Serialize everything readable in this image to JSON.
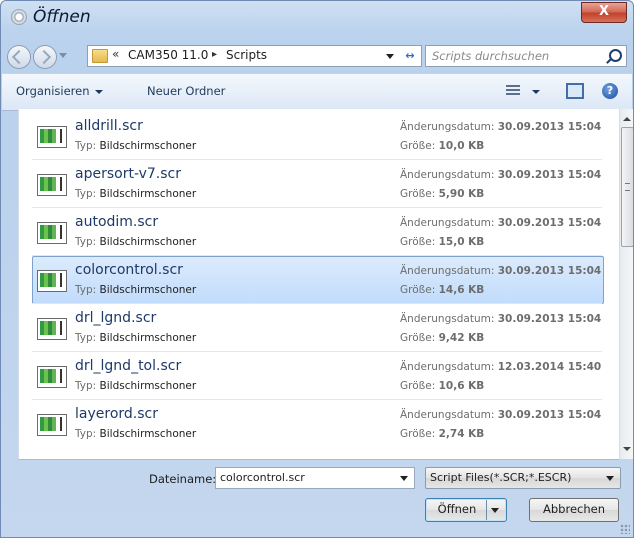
{
  "window": {
    "title": "Öffnen",
    "close_label": "X"
  },
  "address": {
    "overflow": "«",
    "crumbs": [
      "CAM350 11.0",
      "Scripts"
    ],
    "separator": "▸"
  },
  "search": {
    "placeholder": "Scripts durchsuchen"
  },
  "toolbar": {
    "organize": "Organisieren",
    "new_folder": "Neuer Ordner",
    "help": "?"
  },
  "labels": {
    "type": "Typ:",
    "date": "Änderungsdatum:",
    "size": "Größe:"
  },
  "files": [
    {
      "name": "alldrill.scr",
      "type": "Bildschirmschoner",
      "date": "30.09.2013 15:04",
      "size": "10,0 KB",
      "selected": false
    },
    {
      "name": "apersort-v7.scr",
      "type": "Bildschirmschoner",
      "date": "30.09.2013 15:04",
      "size": "5,90 KB",
      "selected": false
    },
    {
      "name": "autodim.scr",
      "type": "Bildschirmschoner",
      "date": "30.09.2013 15:04",
      "size": "15,0 KB",
      "selected": false
    },
    {
      "name": "colorcontrol.scr",
      "type": "Bildschirmschoner",
      "date": "30.09.2013 15:04",
      "size": "14,6 KB",
      "selected": true
    },
    {
      "name": "drl_lgnd.scr",
      "type": "Bildschirmschoner",
      "date": "30.09.2013 15:04",
      "size": "9,42 KB",
      "selected": false
    },
    {
      "name": "drl_lgnd_tol.scr",
      "type": "Bildschirmschoner",
      "date": "12.03.2014 15:40",
      "size": "10,6 KB",
      "selected": false
    },
    {
      "name": "layerord.scr",
      "type": "Bildschirmschoner",
      "date": "30.09.2013 15:04",
      "size": "2,74 KB",
      "selected": false
    }
  ],
  "bottom": {
    "filename_label": "Dateiname:",
    "filename_value": "colorcontrol.scr",
    "filetype_value": "Script Files(*.SCR;*.ESCR)",
    "open_label": "Öffnen",
    "cancel_label": "Abbrechen"
  }
}
